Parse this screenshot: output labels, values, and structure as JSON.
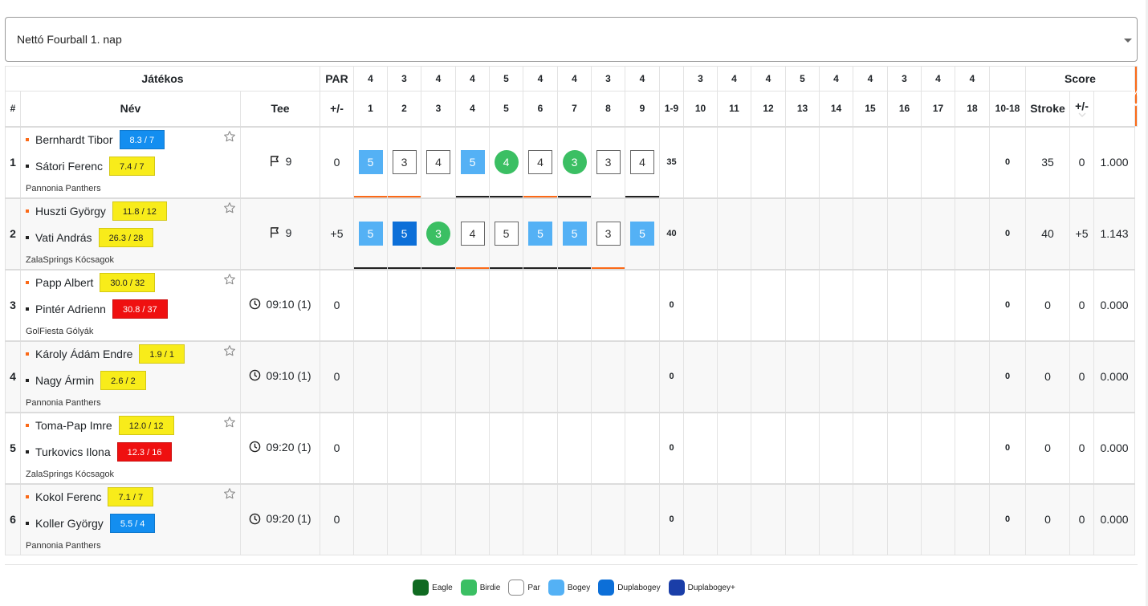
{
  "round_selector": {
    "value": "Nettó Fourball 1. nap"
  },
  "header": {
    "player_group": "Játékos",
    "par_label": "PAR",
    "score_group": "Score",
    "hash": "#",
    "name": "Név",
    "tee": "Tee",
    "plusminus": "+/-",
    "front_label": "1-9",
    "back_label": "10-18",
    "stroke": "Stroke",
    "score_plusminus": "+/-",
    "percent": "%",
    "holes": [
      "1",
      "2",
      "3",
      "4",
      "5",
      "6",
      "7",
      "8",
      "9",
      "10",
      "11",
      "12",
      "13",
      "14",
      "15",
      "16",
      "17",
      "18"
    ],
    "pars": [
      "4",
      "3",
      "4",
      "4",
      "5",
      "4",
      "4",
      "3",
      "4",
      "3",
      "4",
      "4",
      "5",
      "4",
      "4",
      "3",
      "4",
      "4"
    ]
  },
  "rows": [
    {
      "pos": "1",
      "players": [
        {
          "name": "Bernhardt Tibor",
          "marker": "orange",
          "hcp": "8.3 / 7",
          "hcp_color": "blue"
        },
        {
          "name": "Sátori Ferenc",
          "marker": "black",
          "hcp": "7.4 / 7",
          "hcp_color": "yellow"
        }
      ],
      "club": "Pannonia Panthers",
      "tee_icon": "flag-icon",
      "tee": "9",
      "par_diff": "0",
      "holes": [
        {
          "s": "5",
          "t": "bogey",
          "u": "o"
        },
        {
          "s": "3",
          "t": "par",
          "u": "o"
        },
        {
          "s": "4",
          "t": "par",
          "u": ""
        },
        {
          "s": "5",
          "t": "bogey",
          "u": "k"
        },
        {
          "s": "4",
          "t": "birdie",
          "u": "k"
        },
        {
          "s": "4",
          "t": "par",
          "u": "o"
        },
        {
          "s": "3",
          "t": "birdie",
          "u": "k"
        },
        {
          "s": "3",
          "t": "par",
          "u": ""
        },
        {
          "s": "4",
          "t": "par",
          "u": "k"
        }
      ],
      "front": "35",
      "back": "0",
      "stroke": "35",
      "diff": "0",
      "pct": "1.000"
    },
    {
      "pos": "2",
      "players": [
        {
          "name": "Huszti György",
          "marker": "orange",
          "hcp": "11.8 / 12",
          "hcp_color": "yellow"
        },
        {
          "name": "Vati András",
          "marker": "black",
          "hcp": "26.3 / 28",
          "hcp_color": "yellow"
        }
      ],
      "club": "ZalaSprings Kócsagok",
      "tee_icon": "flag-icon",
      "tee": "9",
      "par_diff": "+5",
      "holes": [
        {
          "s": "5",
          "t": "bogey",
          "u": "k"
        },
        {
          "s": "5",
          "t": "dbogey",
          "u": "k"
        },
        {
          "s": "3",
          "t": "birdie",
          "u": "k"
        },
        {
          "s": "4",
          "t": "par",
          "u": "o"
        },
        {
          "s": "5",
          "t": "par",
          "u": "k"
        },
        {
          "s": "5",
          "t": "bogey",
          "u": "k"
        },
        {
          "s": "5",
          "t": "bogey",
          "u": "k"
        },
        {
          "s": "3",
          "t": "par",
          "u": "o"
        },
        {
          "s": "5",
          "t": "bogey",
          "u": ""
        }
      ],
      "front": "40",
      "back": "0",
      "stroke": "40",
      "diff": "+5",
      "pct": "1.143"
    },
    {
      "pos": "3",
      "players": [
        {
          "name": "Papp Albert",
          "marker": "orange",
          "hcp": "30.0 / 32",
          "hcp_color": "yellow"
        },
        {
          "name": "Pintér Adrienn",
          "marker": "black",
          "hcp": "30.8 / 37",
          "hcp_color": "red"
        }
      ],
      "club": "GolFiesta Gólyák",
      "tee_icon": "clock-icon",
      "tee": "09:10 (1)",
      "par_diff": "0",
      "holes": [],
      "front": "0",
      "back": "0",
      "stroke": "0",
      "diff": "0",
      "pct": "0.000"
    },
    {
      "pos": "4",
      "players": [
        {
          "name": "Károly Ádám Endre",
          "marker": "orange",
          "hcp": "1.9 / 1",
          "hcp_color": "yellow"
        },
        {
          "name": "Nagy Ármin",
          "marker": "black",
          "hcp": "2.6 / 2",
          "hcp_color": "yellow"
        }
      ],
      "club": "Pannonia Panthers",
      "tee_icon": "clock-icon",
      "tee": "09:10 (1)",
      "par_diff": "0",
      "holes": [],
      "front": "0",
      "back": "0",
      "stroke": "0",
      "diff": "0",
      "pct": "0.000"
    },
    {
      "pos": "5",
      "players": [
        {
          "name": "Toma-Pap Imre",
          "marker": "orange",
          "hcp": "12.0 / 12",
          "hcp_color": "yellow"
        },
        {
          "name": "Turkovics Ilona",
          "marker": "black",
          "hcp": "12.3 / 16",
          "hcp_color": "red"
        }
      ],
      "club": "ZalaSprings Kócsagok",
      "tee_icon": "clock-icon",
      "tee": "09:20 (1)",
      "par_diff": "0",
      "holes": [],
      "front": "0",
      "back": "0",
      "stroke": "0",
      "diff": "0",
      "pct": "0.000"
    },
    {
      "pos": "6",
      "players": [
        {
          "name": "Kokol Ferenc",
          "marker": "orange",
          "hcp": "7.1 / 7",
          "hcp_color": "yellow"
        },
        {
          "name": "Koller György",
          "marker": "black",
          "hcp": "5.5 / 4",
          "hcp_color": "blue"
        }
      ],
      "club": "Pannonia Panthers",
      "tee_icon": "clock-icon",
      "tee": "09:20 (1)",
      "par_diff": "0",
      "holes": [],
      "front": "0",
      "back": "0",
      "stroke": "0",
      "diff": "0",
      "pct": "0.000"
    }
  ],
  "legend": [
    {
      "label": "Eagle",
      "color": "#0f6a21"
    },
    {
      "label": "Birdie",
      "color": "#3bbf63"
    },
    {
      "label": "Par",
      "color": "#ffffff"
    },
    {
      "label": "Bogey",
      "color": "#54b1f5"
    },
    {
      "label": "Duplabogey",
      "color": "#0c6fd8"
    },
    {
      "label": "Duplabogey+",
      "color": "#1a3ea8"
    }
  ]
}
